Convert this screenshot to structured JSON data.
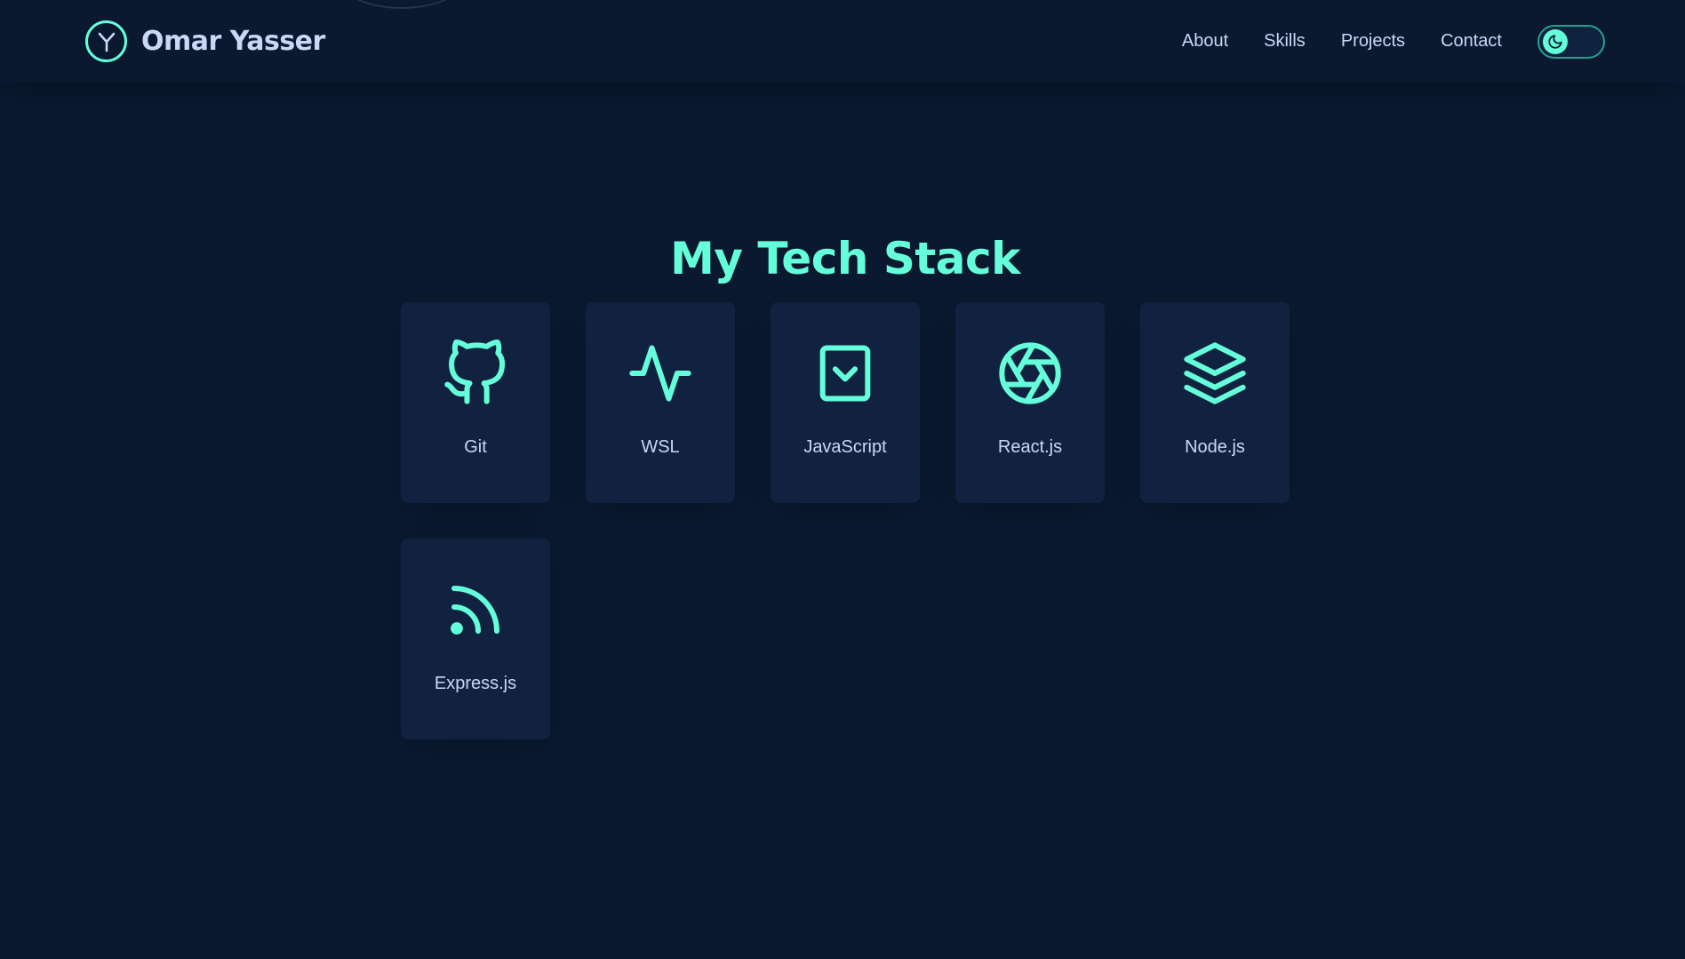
{
  "brand": {
    "logo_letter": "Y",
    "name": "Omar Yasser"
  },
  "nav": {
    "links": [
      {
        "label": "About"
      },
      {
        "label": "Skills"
      },
      {
        "label": "Projects"
      },
      {
        "label": "Contact"
      }
    ],
    "theme_toggle_icon": "moon-icon"
  },
  "skills": {
    "title": "My Tech Stack",
    "items": [
      {
        "label": "Git",
        "icon": "github-icon"
      },
      {
        "label": "WSL",
        "icon": "activity-icon"
      },
      {
        "label": "JavaScript",
        "icon": "chevron-down-square-icon"
      },
      {
        "label": "React.js",
        "icon": "aperture-icon"
      },
      {
        "label": "Node.js",
        "icon": "layers-icon"
      },
      {
        "label": "Express.js",
        "icon": "rss-icon"
      }
    ]
  },
  "colors": {
    "background": "#0a192f",
    "card": "#112240",
    "accent": "#64ffda",
    "text": "#ccd6f6"
  }
}
